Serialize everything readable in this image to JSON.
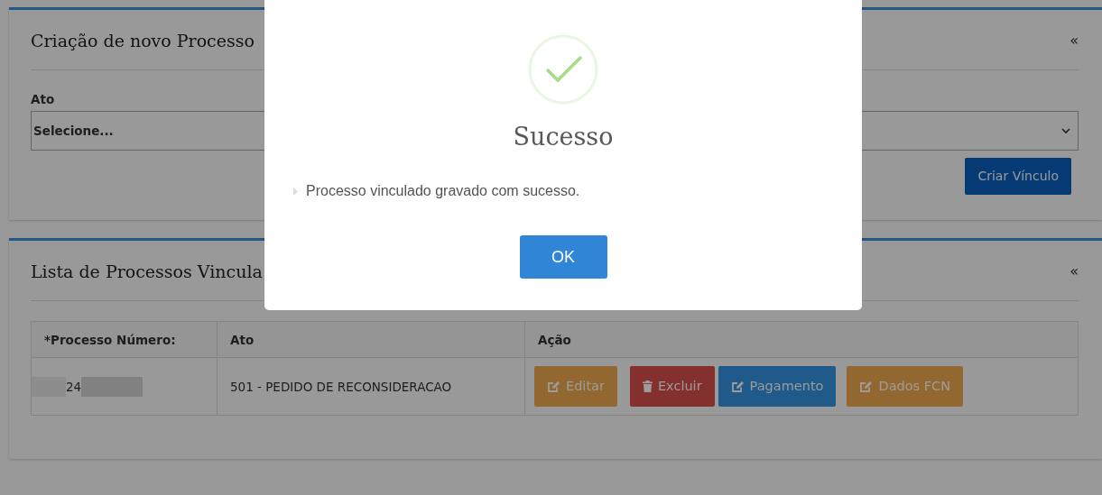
{
  "panels": [
    {
      "title": "Criação de novo Processo",
      "collapse": "«",
      "field": {
        "label": "Ato",
        "value": "Selecione..."
      },
      "button": "Criar Vínculo"
    },
    {
      "title": "Lista de Processos Vincula",
      "collapse": "«",
      "table": {
        "columns": [
          "*Processo Número:",
          "Ato",
          "Ação"
        ],
        "rows": [
          {
            "process_number": "24",
            "ato": "501 - PEDIDO DE RECONSIDERACAO",
            "actions": [
              {
                "label": "Editar",
                "kind": "edit",
                "color": "#936830"
              },
              {
                "label": "Excluir",
                "kind": "delete",
                "color": "#84302f"
              },
              {
                "label": "Pagamento",
                "kind": "edit",
                "color": "#1f5a8a"
              },
              {
                "label": "Dados FCN",
                "kind": "edit",
                "color": "#936830"
              }
            ]
          }
        ]
      }
    }
  ],
  "modal": {
    "title": "Sucesso",
    "message": "Processo vinculado gravado com sucesso.",
    "button": "OK"
  }
}
